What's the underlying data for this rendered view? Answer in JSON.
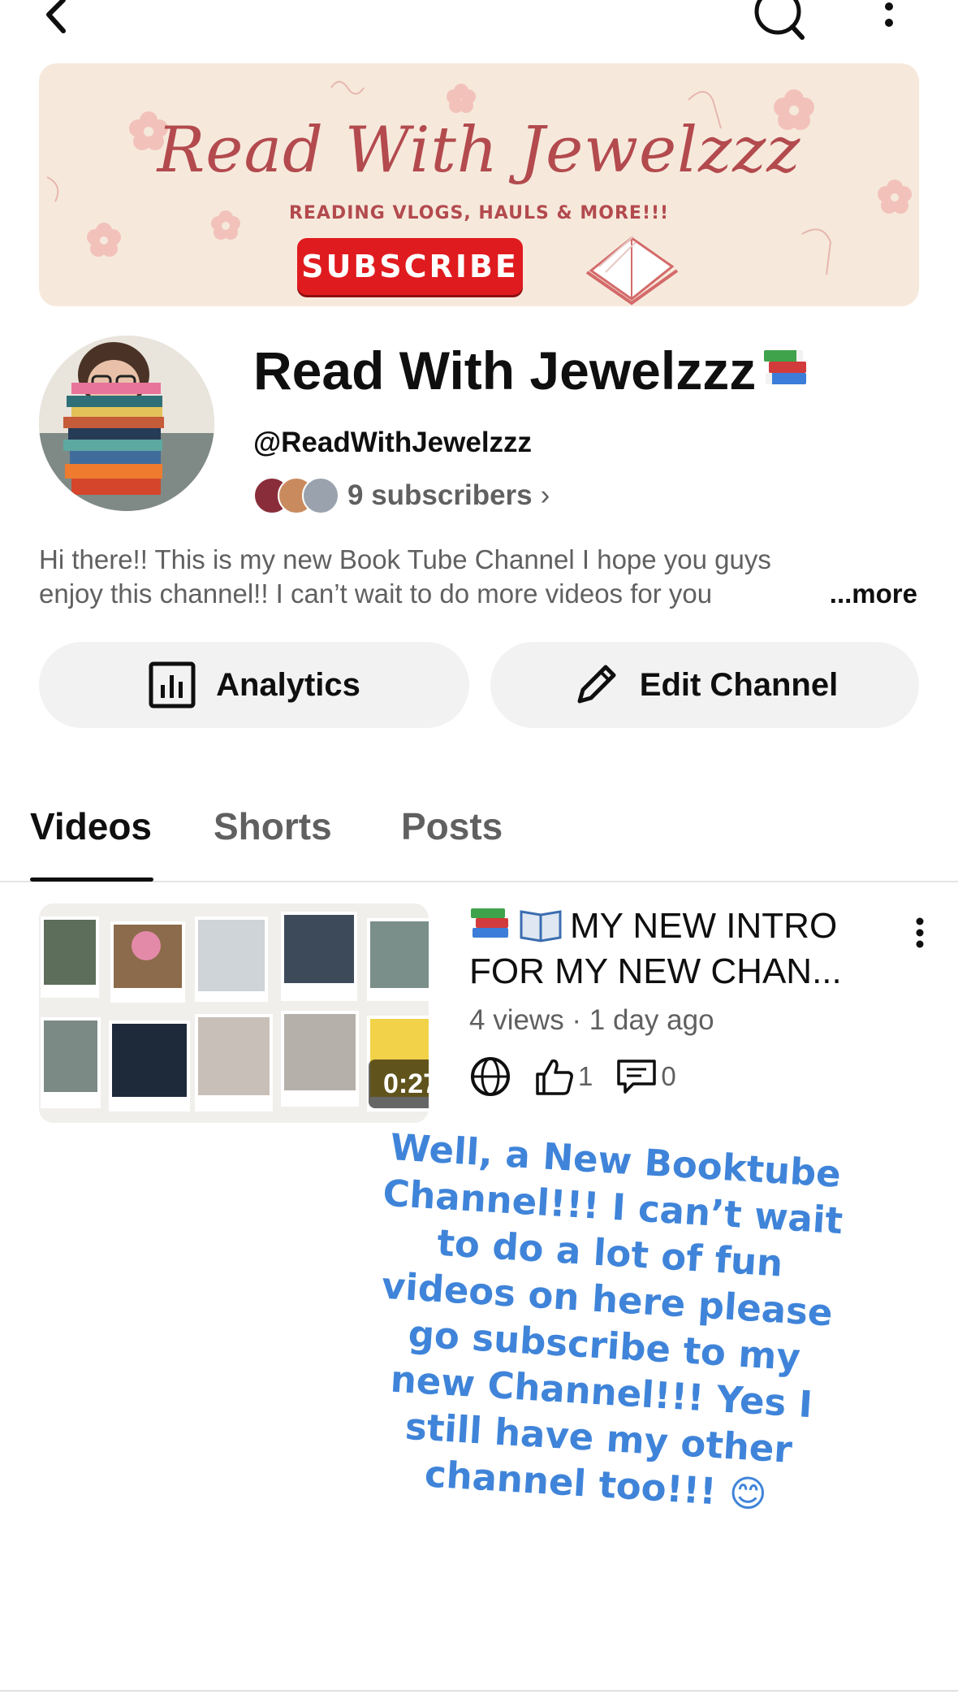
{
  "banner": {
    "title": "Read With Jewelzzz",
    "subtitle": "READING VLOGS, HAULS & MORE!!!",
    "subscribe_label": "SUBSCRIBE"
  },
  "channel": {
    "name": "Read With Jewelzzz",
    "handle": "@ReadWithJewelzzz",
    "subscribers": "9 subscribers",
    "description": "Hi there!! This is my new Book Tube Channel I hope you guys enjoy this channel!!  I can’t wait to do more videos for you",
    "more_label": "...more"
  },
  "actions": {
    "analytics_label": "Analytics",
    "edit_label": "Edit Channel"
  },
  "tabs": [
    {
      "label": "Videos",
      "selected": true
    },
    {
      "label": "Shorts",
      "selected": false
    },
    {
      "label": "Posts",
      "selected": false
    }
  ],
  "video": {
    "title": "MY NEW INTRO FOR MY NEW CHAN...",
    "meta": "4 views · 1 day ago",
    "duration": "0:27",
    "likes": "1",
    "comments": "0",
    "visibility_icon": "globe-icon"
  },
  "overlay": {
    "text": "Well, a New Booktube Channel!!! I can’t wait to do a lot of fun videos on here please go subscribe to my new Channel!!! Yes I still have my other channel too!!! 😊"
  },
  "colors": {
    "accent_red": "#e01b1f",
    "banner_bg": "#f6e9dc",
    "banner_text": "#b34a4e",
    "overlay_text": "#3f84d9",
    "pill_bg": "#f2f2f2",
    "secondary_text": "#606060"
  }
}
